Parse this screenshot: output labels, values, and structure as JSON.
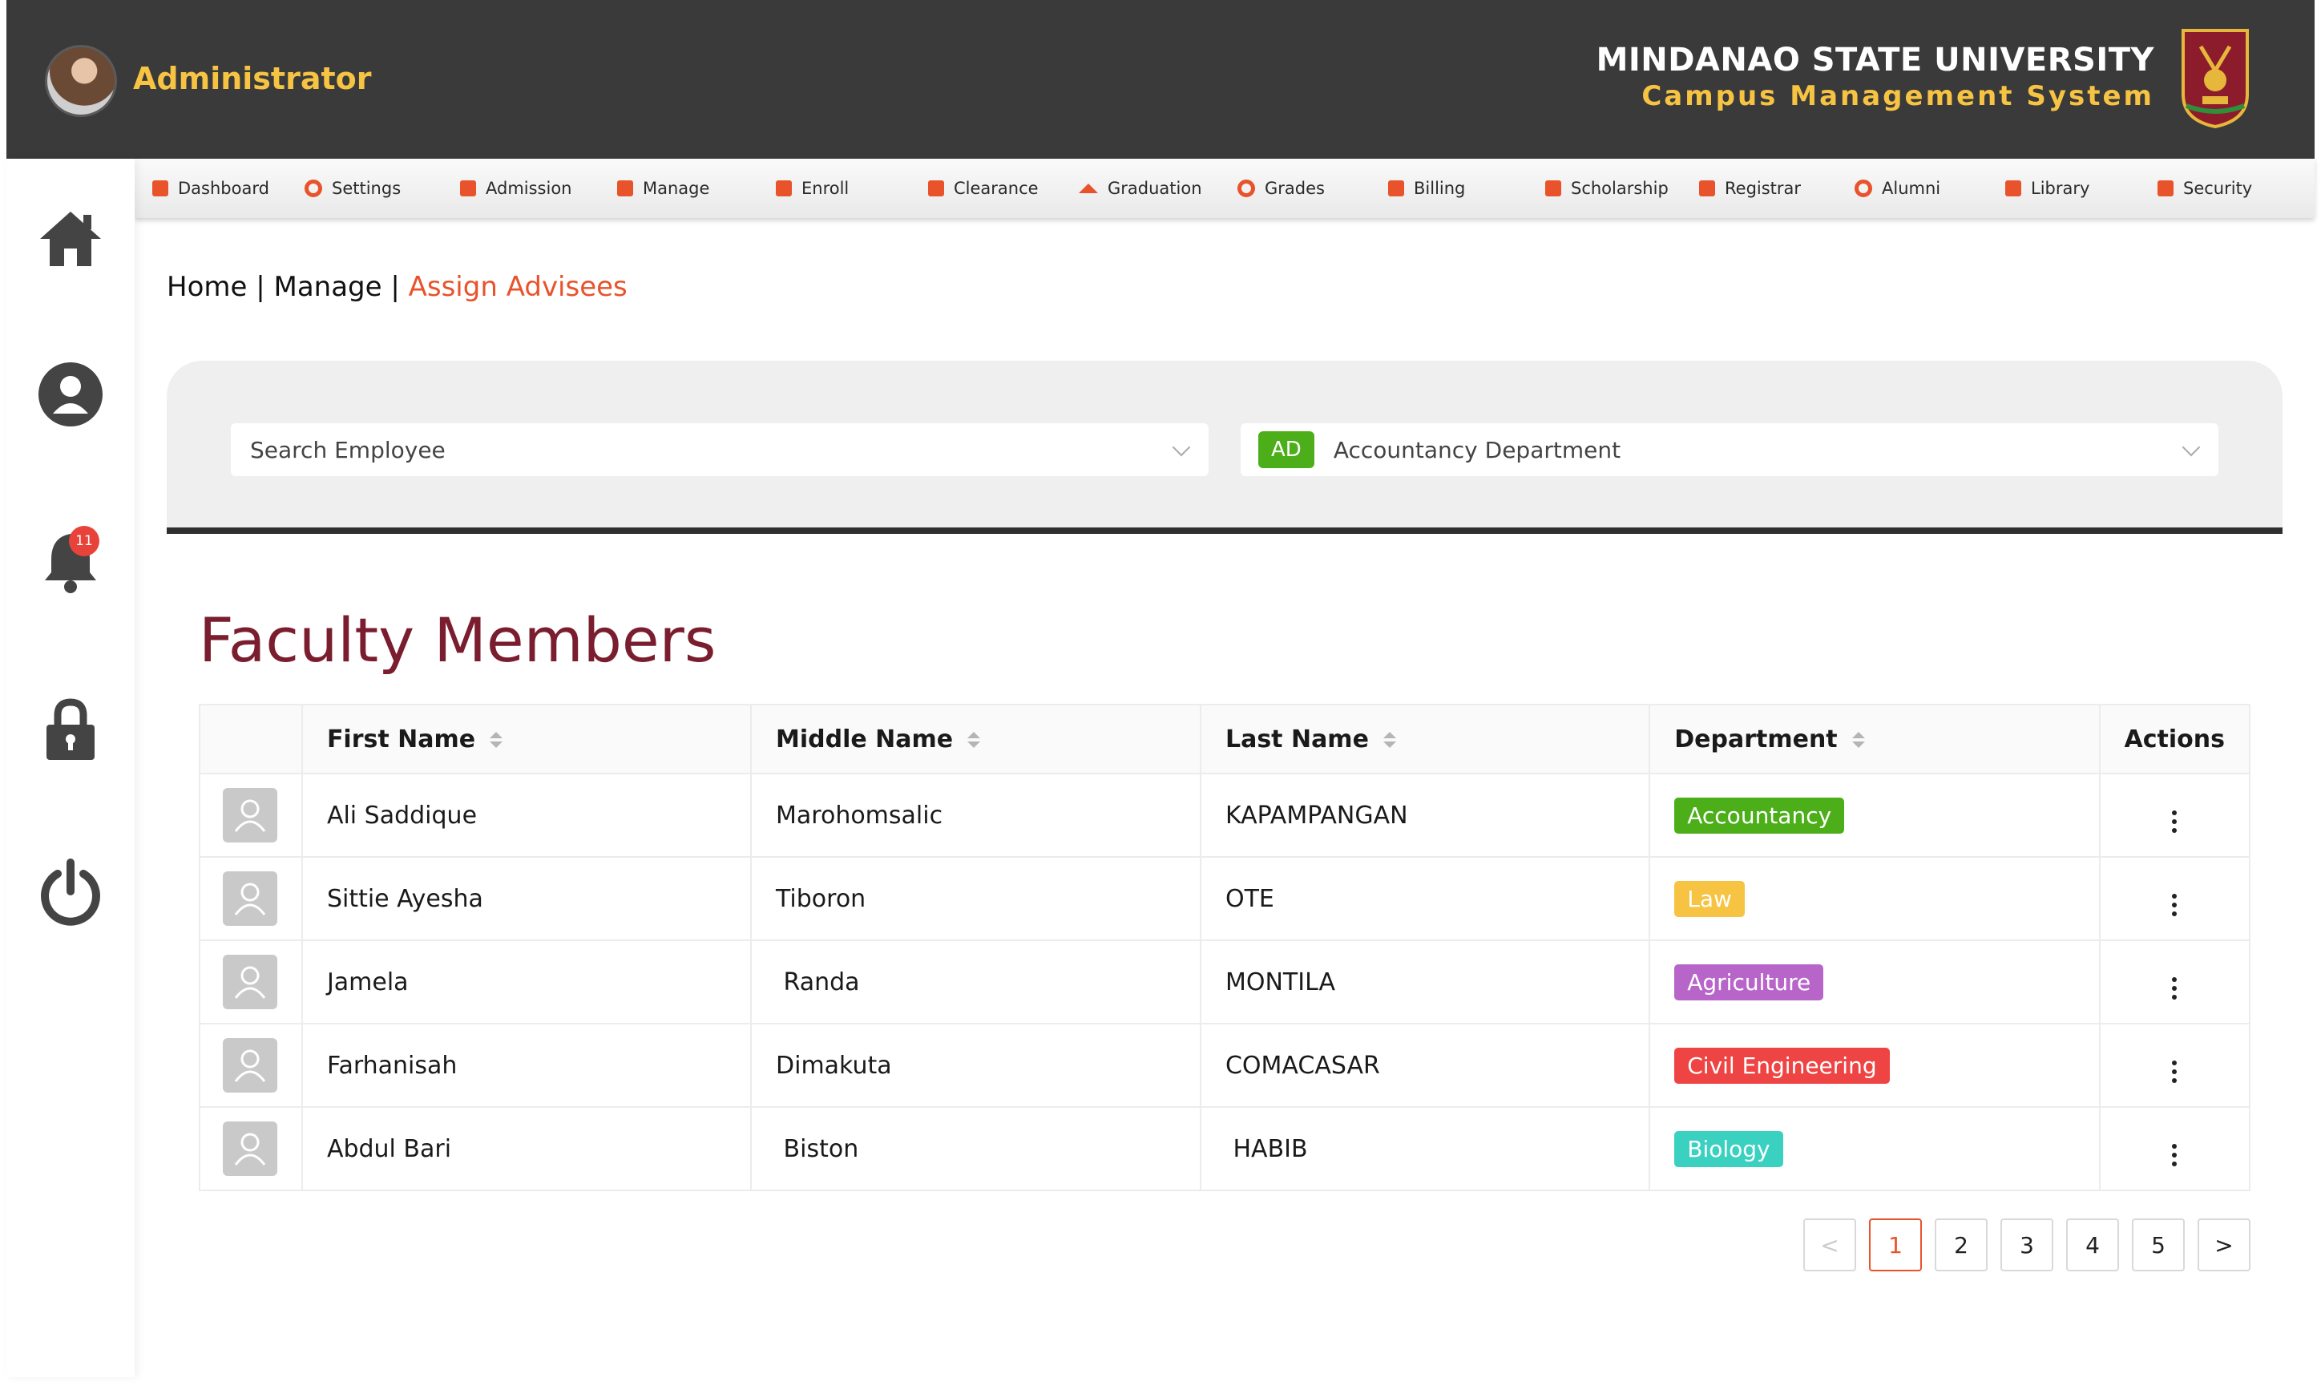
{
  "header": {
    "role": "Administrator",
    "university": "MINDANAO STATE UNIVERSITY",
    "system": "Campus Management System"
  },
  "menu": [
    {
      "label": "Dashboard",
      "icon": "dashboard-icon"
    },
    {
      "label": "Settings",
      "icon": "gear-icon"
    },
    {
      "label": "Admission",
      "icon": "admission-icon"
    },
    {
      "label": "Manage",
      "icon": "manage-icon"
    },
    {
      "label": "Enroll",
      "icon": "enroll-icon"
    },
    {
      "label": "Clearance",
      "icon": "clearance-icon"
    },
    {
      "label": "Graduation",
      "icon": "graduation-cap-icon"
    },
    {
      "label": "Grades",
      "icon": "grades-icon"
    },
    {
      "label": "Billing",
      "icon": "billing-icon"
    },
    {
      "label": "Scholarship",
      "icon": "scholarship-icon"
    },
    {
      "label": "Registrar",
      "icon": "registrar-icon"
    },
    {
      "label": "Alumni",
      "icon": "alumni-icon"
    },
    {
      "label": "Library",
      "icon": "library-icon"
    },
    {
      "label": "Security",
      "icon": "security-icon"
    }
  ],
  "sidebar": {
    "items": [
      "home-icon",
      "user-icon",
      "bell-icon",
      "lock-icon",
      "power-icon"
    ],
    "notification_count": "11"
  },
  "breadcrumb": {
    "home": "Home",
    "sep": " | ",
    "manage": "Manage",
    "current": "Assign Advisees"
  },
  "filters": {
    "employee_placeholder": "Search Employee",
    "department_tag": "AD",
    "department_value": "Accountancy Department"
  },
  "faculty": {
    "title": "Faculty Members",
    "columns": {
      "first": "First Name",
      "middle": "Middle Name",
      "last": "Last Name",
      "department": "Department",
      "actions": "Actions"
    },
    "rows": [
      {
        "first": "Ali Saddique",
        "middle": "Marohomsalic",
        "last": "KAPAMPANGAN",
        "department": "Accountancy"
      },
      {
        "first": "Sittie Ayesha",
        "middle": "Tiboron",
        "last": "OTE",
        "department": "Law"
      },
      {
        "first": "Jamela",
        "middle": " Randa",
        "last": "MONTILA",
        "department": "Agriculture"
      },
      {
        "first": "Farhanisah",
        "middle": "Dimakuta",
        "last": "COMACASAR",
        "department": "Civil Engineering"
      },
      {
        "first": "Abdul Bari",
        "middle": " Biston",
        "last": " HABIB",
        "department": "Biology"
      }
    ]
  },
  "department_colors": {
    "Accountancy": "#4caf1a",
    "Law": "#f6c343",
    "Agriculture": "#b865c9",
    "Civil Engineering": "#ef4444",
    "Biology": "#3ad1c0"
  },
  "pagination": {
    "prev": "<",
    "pages": [
      "1",
      "2",
      "3",
      "4",
      "5"
    ],
    "current": "1",
    "next": ">"
  },
  "colors": {
    "accent": "#e8532c",
    "header_bg": "#3a3a3a",
    "gold": "#f6c343",
    "title": "#7a1d2e"
  }
}
